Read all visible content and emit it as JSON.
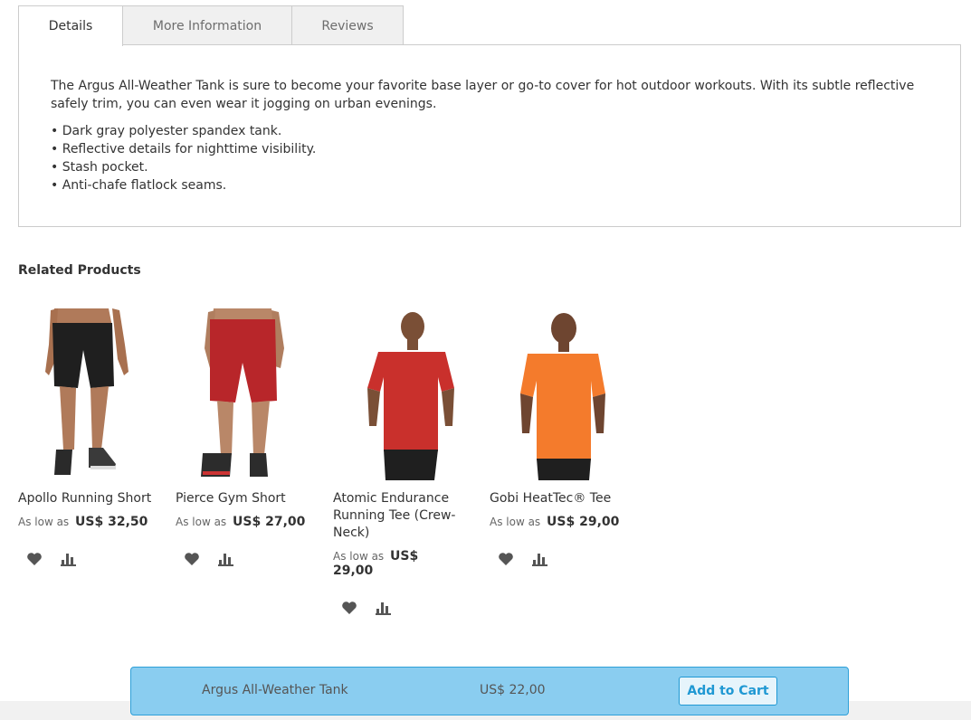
{
  "tabs": [
    {
      "label": "Details",
      "active": true
    },
    {
      "label": "More Information",
      "active": false
    },
    {
      "label": "Reviews",
      "active": false
    }
  ],
  "details": {
    "description": "The Argus All-Weather Tank is sure to become your favorite base layer or go-to cover for hot outdoor workouts. With its subtle reflective safely trim, you can even wear it jogging on urban evenings.",
    "features": [
      "Dark gray polyester spandex tank.",
      "Reflective details for nighttime visibility.",
      "Stash pocket.",
      "Anti-chafe flatlock seams."
    ]
  },
  "related": {
    "title": "Related Products",
    "products": [
      {
        "name": "Apollo Running Short",
        "price_prefix": "As low as",
        "price": "US$ 32,50"
      },
      {
        "name": "Pierce Gym Short",
        "price_prefix": "As low as",
        "price": "US$ 27,00"
      },
      {
        "name": "Atomic Endurance Running Tee (Crew-Neck)",
        "price_prefix": "As low as",
        "price": "US$ 29,00"
      },
      {
        "name": "Gobi HeatTec® Tee",
        "price_prefix": "As low as",
        "price": "US$ 29,00"
      }
    ]
  },
  "sticky": {
    "product_name": "Argus All-Weather Tank",
    "price": "US$ 22,00",
    "button_label": "Add to Cart"
  },
  "colors": {
    "sticky_bg": "#8acdf0",
    "accent": "#1f98d3",
    "short_black": "#1f1f1f",
    "short_red": "#b8262a",
    "tee_red": "#c9302c",
    "tee_orange": "#f47b2c"
  },
  "icons": {
    "wishlist": "heart-icon",
    "compare": "compare-bars-icon"
  }
}
